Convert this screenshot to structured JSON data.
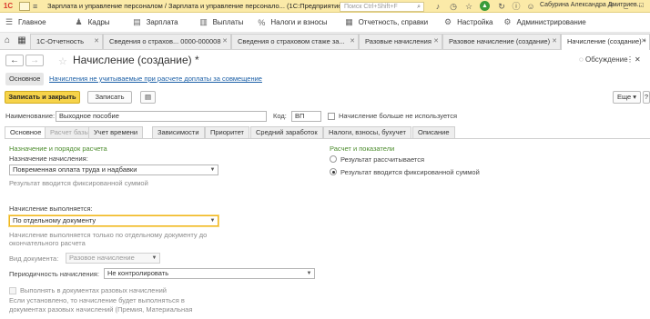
{
  "titlebar": {
    "logo": "1С",
    "title": "Зарплата и управление персоналом / Зарплата и управление персонало... (1С:Предприятие)",
    "search_placeholder": "Поиск Ctrl+Shift+F",
    "user": "Сабурина Александра Дмитриев..."
  },
  "menu": {
    "items": [
      {
        "label": "Главное",
        "icon": "home-icon"
      },
      {
        "label": "Кадры",
        "icon": "people-icon"
      },
      {
        "label": "Зарплата",
        "icon": "payroll-icon"
      },
      {
        "label": "Выплаты",
        "icon": "payments-icon"
      },
      {
        "label": "Налоги и взносы",
        "icon": "percent-icon"
      },
      {
        "label": "Отчетность, справки",
        "icon": "reports-icon"
      },
      {
        "label": "Настройка",
        "icon": "settings-icon"
      },
      {
        "label": "Администрирование",
        "icon": "admin-icon"
      }
    ]
  },
  "window_tabs": [
    {
      "label": "1С-Отчетность"
    },
    {
      "label": "Сведения о страхов... 0000-000008"
    },
    {
      "label": "Сведения о страховом стаже за..."
    },
    {
      "label": "Разовые начисления"
    },
    {
      "label": "Разовое начисление (создание)"
    },
    {
      "label": "Начисление (создание) *"
    }
  ],
  "form": {
    "title": "Начисление (создание) *",
    "discussion_label": "Обсуждение",
    "view_tabs": {
      "main": "Основное",
      "link": "Начисления не учитываемые при расчете доплаты за совмещение"
    },
    "toolbar": {
      "save_close": "Записать и закрыть",
      "save": "Записать",
      "more": "Еще",
      "help": "?"
    },
    "name_label": "Наименование:",
    "name_value": "Выходное пособие",
    "code_label": "Код:",
    "code_value": "ВП",
    "unused_label": "Начисление больше не используется",
    "tabs": [
      "Основное",
      "Расчет базы",
      "Учет времени",
      "Зависимости",
      "Приоритет",
      "Средний заработок",
      "Налоги, взносы, бухучет",
      "Описание"
    ],
    "left": {
      "section_title": "Назначение и порядок расчета",
      "purpose_label": "Назначение начисления:",
      "purpose_value": "Повременная оплата труда и надбавки",
      "result_note": "Результат вводится фиксированной суммой",
      "exec_label": "Начисление выполняется:",
      "exec_value": "По отдельному документу",
      "exec_note": "Начисление выполняется только по отдельному документу до окончательного расчета",
      "doc_type_label": "Вид документа:",
      "doc_type_value": "Разовое начисление",
      "period_label": "Периодичность начисления:",
      "period_value": "Не контролировать",
      "one_time_label": "Выполнять в документах разовых начислений",
      "one_time_note_1": "Если установлено, то начисление будет выполняться в",
      "one_time_note_2": "документах разовых начислений (Премия, Материальная"
    },
    "right": {
      "section_title": "Расчет и показатели",
      "radio_calc": "Результат рассчитывается",
      "radio_fixed": "Результат вводится фиксированной суммой"
    }
  },
  "colors": {
    "titlebar_bg": "#fbeaa8",
    "primary_button": "#f6d34a",
    "section_heading": "#4c8c2d",
    "link": "#1b5fa6",
    "focus": "#f0b51e"
  }
}
